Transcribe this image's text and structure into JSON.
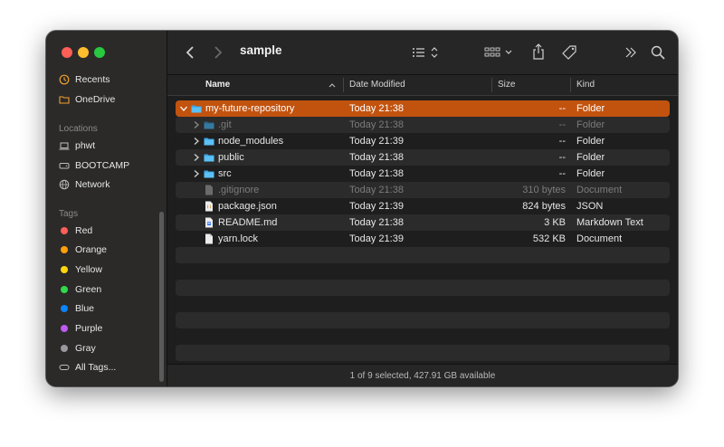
{
  "window": {
    "title": "sample"
  },
  "sidebar": {
    "favorites": [
      {
        "label": "Recents",
        "icon": "clock-icon"
      },
      {
        "label": "OneDrive",
        "icon": "folder-icon"
      }
    ],
    "locations_header": "Locations",
    "locations": [
      {
        "label": "phwt",
        "icon": "laptop-icon"
      },
      {
        "label": "BOOTCAMP",
        "icon": "drive-icon"
      },
      {
        "label": "Network",
        "icon": "globe-icon"
      }
    ],
    "tags_header": "Tags",
    "tags": [
      {
        "label": "Red",
        "color": "#fe5f57"
      },
      {
        "label": "Orange",
        "color": "#fe9f0a"
      },
      {
        "label": "Yellow",
        "color": "#ffd60a"
      },
      {
        "label": "Green",
        "color": "#32d74b"
      },
      {
        "label": "Blue",
        "color": "#0a84ff"
      },
      {
        "label": "Purple",
        "color": "#bf5af2"
      },
      {
        "label": "Gray",
        "color": "#98989d"
      }
    ],
    "all_tags": "All Tags..."
  },
  "columns": {
    "name": "Name",
    "date": "Date Modified",
    "size": "Size",
    "kind": "Kind"
  },
  "files": [
    {
      "name": "my-future-repository",
      "date": "Today 21:38",
      "size": "--",
      "kind": "Folder"
    },
    {
      "name": ".git",
      "date": "Today 21:38",
      "size": "--",
      "kind": "Folder"
    },
    {
      "name": "node_modules",
      "date": "Today 21:39",
      "size": "--",
      "kind": "Folder"
    },
    {
      "name": "public",
      "date": "Today 21:38",
      "size": "--",
      "kind": "Folder"
    },
    {
      "name": "src",
      "date": "Today 21:38",
      "size": "--",
      "kind": "Folder"
    },
    {
      "name": ".gitignore",
      "date": "Today 21:38",
      "size": "310 bytes",
      "kind": "Document"
    },
    {
      "name": "package.json",
      "date": "Today 21:39",
      "size": "824 bytes",
      "kind": "JSON"
    },
    {
      "name": "README.md",
      "date": "Today 21:38",
      "size": "3 KB",
      "kind": "Markdown Text"
    },
    {
      "name": "yarn.lock",
      "date": "Today 21:39",
      "size": "532 KB",
      "kind": "Document"
    }
  ],
  "status": "1 of 9 selected, 427.91 GB available",
  "colors": {
    "selection": "#c2530f",
    "folder": "#38a6e8"
  }
}
